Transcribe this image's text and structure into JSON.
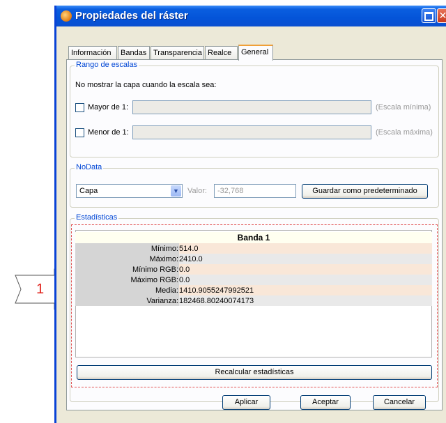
{
  "callout": {
    "number": "1"
  },
  "window": {
    "title": "Propiedades del ráster"
  },
  "tabs": [
    {
      "label": "Información",
      "active": false
    },
    {
      "label": "Bandas",
      "active": false
    },
    {
      "label": "Transparencia",
      "active": false
    },
    {
      "label": "Realce",
      "active": false
    },
    {
      "label": "General",
      "active": true
    }
  ],
  "scale_range": {
    "legend": "Rango de escalas",
    "description": "No mostrar la capa cuando la escala sea:",
    "greater": {
      "label": "Mayor de 1:",
      "checked": false,
      "value": "",
      "hint": "(Escala mínima)"
    },
    "less": {
      "label": "Menor de 1:",
      "checked": false,
      "value": "",
      "hint": "(Escala máxima)"
    }
  },
  "nodata": {
    "legend": "NoData",
    "selected": "Capa",
    "value_label": "Valor:",
    "value": "-32,768",
    "save_default_label": "Guardar como predeterminado"
  },
  "statistics": {
    "legend": "Estadísticas",
    "band_header": "Banda 1",
    "rows": [
      {
        "key": "Mínimo:",
        "value": "514.0"
      },
      {
        "key": "Máximo:",
        "value": "2410.0"
      },
      {
        "key": "Mínimo RGB:",
        "value": "0.0"
      },
      {
        "key": "Máximo RGB:",
        "value": "0.0"
      },
      {
        "key": "Media:",
        "value": "1410.9055247992521"
      },
      {
        "key": "Varianza:",
        "value": "182468.80240074173"
      }
    ],
    "recalc_label": "Recalcular estadísticas"
  },
  "buttons": {
    "apply": "Aplicar",
    "accept": "Aceptar",
    "cancel": "Cancelar"
  },
  "colors": {
    "titlebar": "#0454d8",
    "legend": "#0046d5",
    "dashed_border": "#e05050",
    "accent_tab": "#f0a038"
  }
}
